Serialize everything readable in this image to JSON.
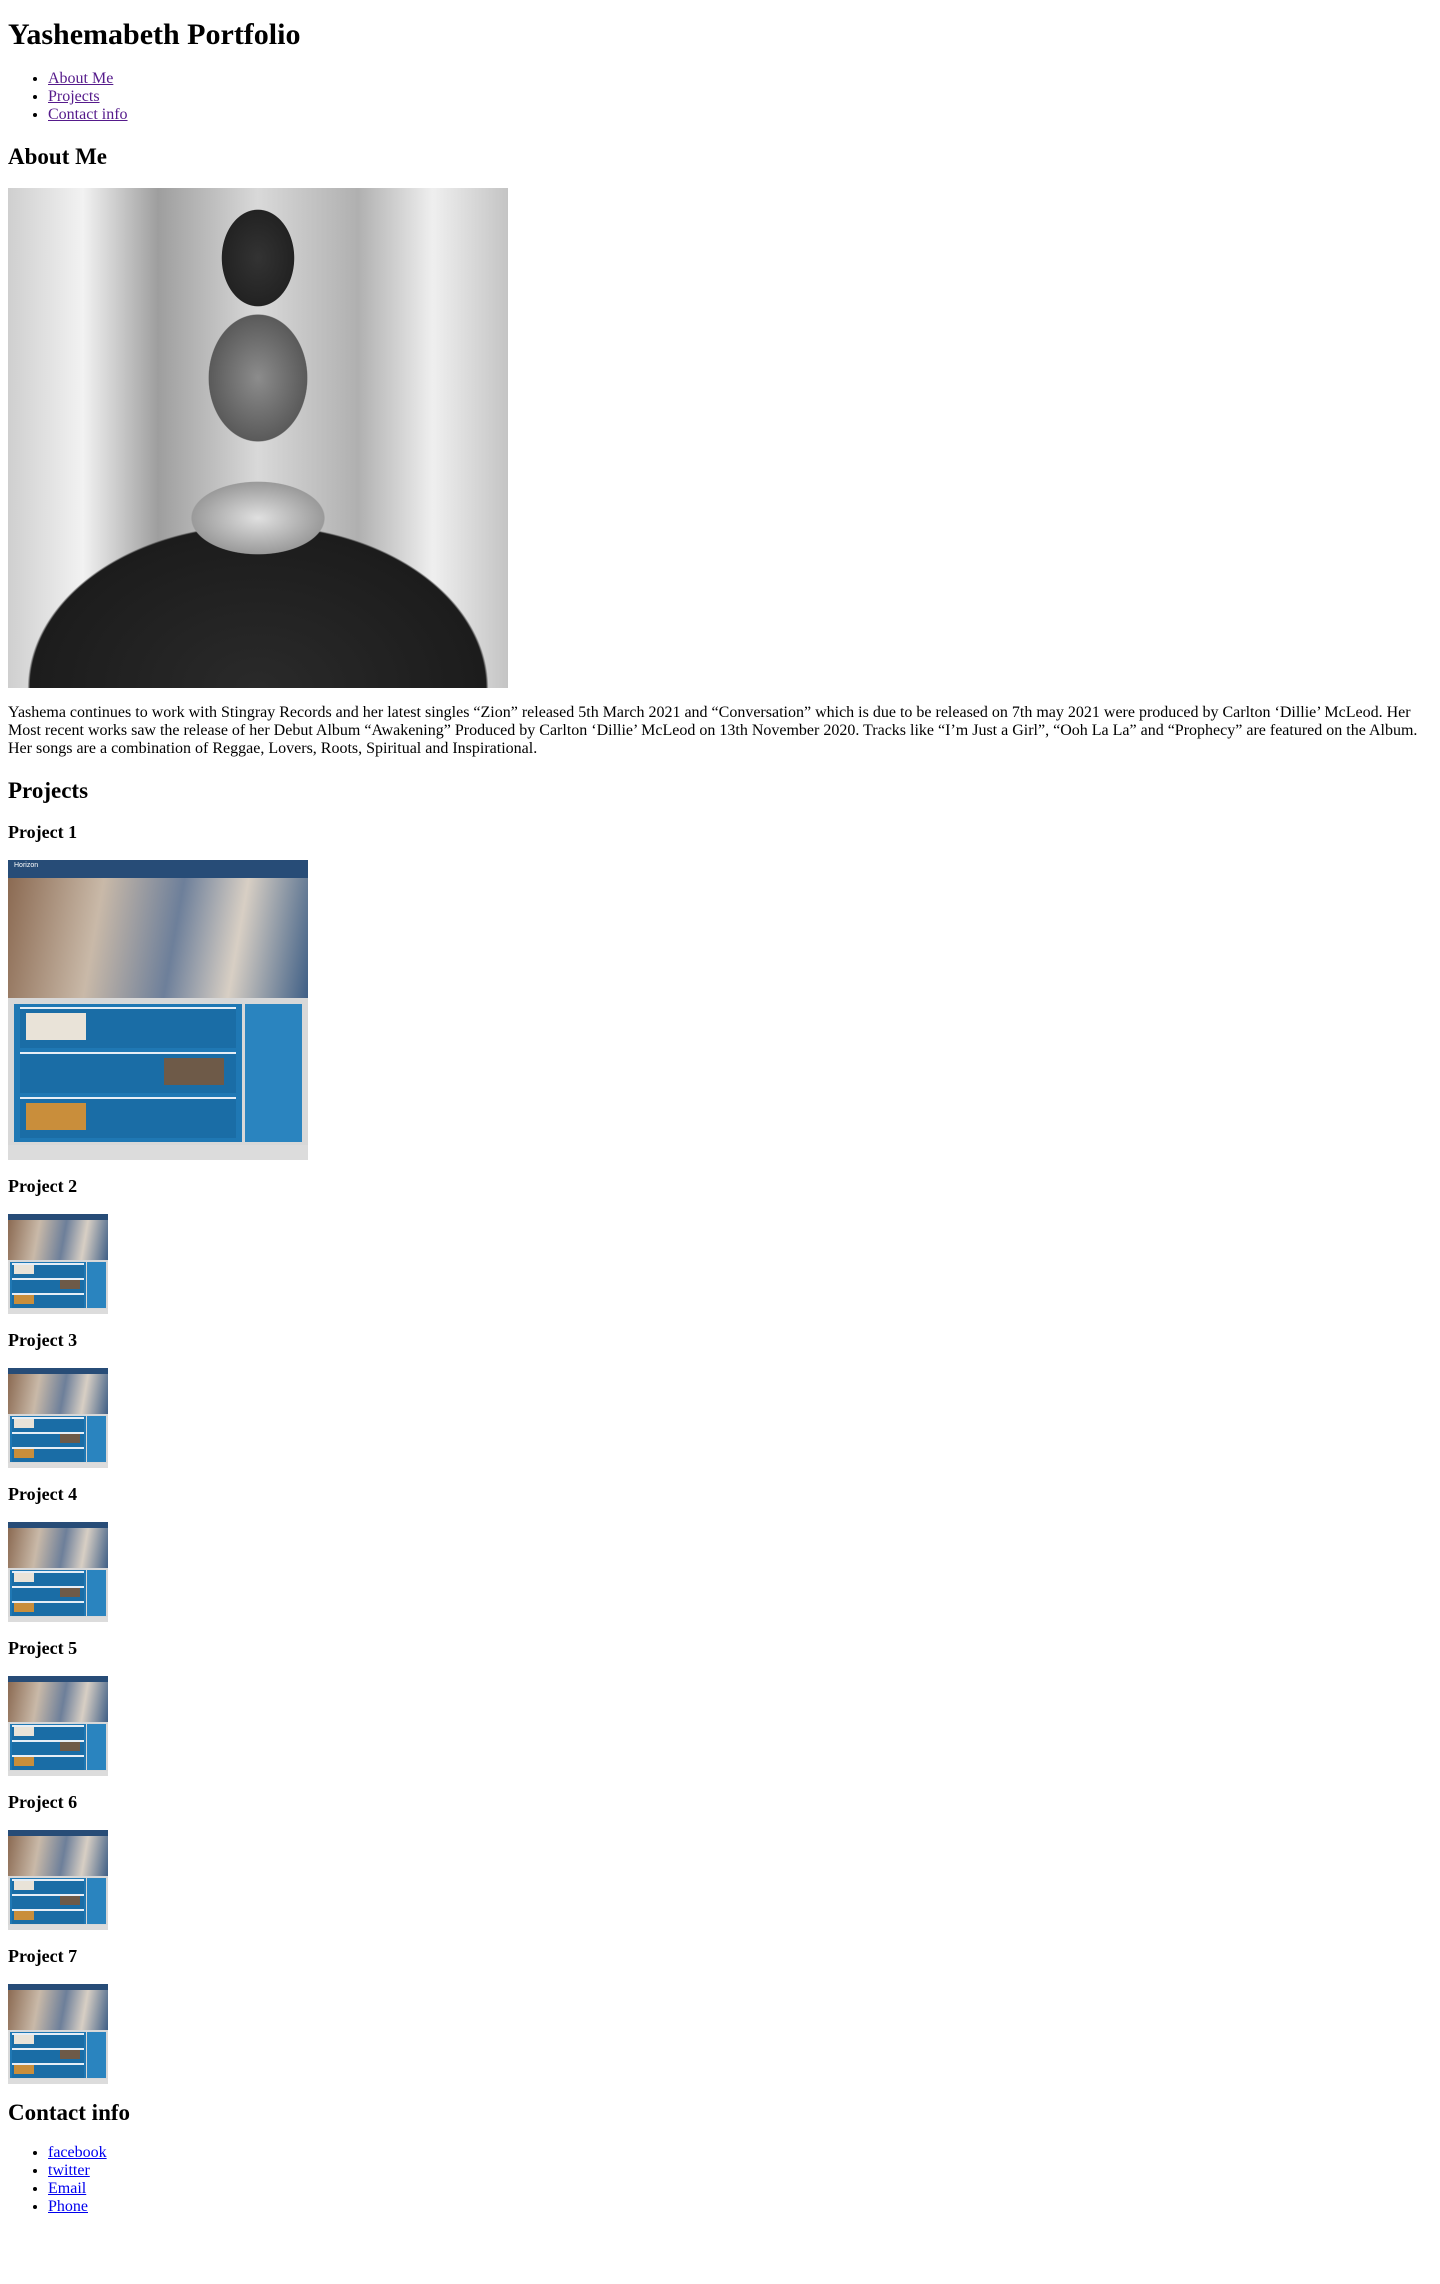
{
  "site": {
    "title": "Yashemabeth Portfolio"
  },
  "nav": {
    "items": [
      {
        "label": "About Me"
      },
      {
        "label": "Projects"
      },
      {
        "label": "Contact info"
      }
    ]
  },
  "about": {
    "heading": "About Me",
    "photo_icon": "portrait-photo",
    "bio": "Yashema continues to work with Stingray Records and her latest singles “Zion” released 5th March 2021 and “Conversation” which is due to be released on 7th may 2021 were produced by Carlton ‘Dillie’ McLeod. Her Most recent works saw the release of her Debut Album “Awakening” Produced by Carlton ‘Dillie’ McLeod on 13th November 2020. Tracks like “I’m Just a Girl”, “Ooh La La” and “Prophecy” are featured on the Album. Her songs are a combination of Reggae, Lovers, Roots, Spiritual and Inspirational."
  },
  "projects": {
    "heading": "Projects",
    "thumbnail_brand": "Horizon",
    "items": [
      {
        "title": "Project 1"
      },
      {
        "title": "Project 2"
      },
      {
        "title": "Project 3"
      },
      {
        "title": "Project 4"
      },
      {
        "title": "Project 5"
      },
      {
        "title": "Project 6"
      },
      {
        "title": "Project 7"
      }
    ]
  },
  "contact": {
    "heading": "Contact info",
    "links": [
      {
        "label": "facebook"
      },
      {
        "label": "twitter"
      },
      {
        "label": "Email"
      },
      {
        "label": "Phone"
      }
    ]
  },
  "colors": {
    "visited_link": "#551a8b",
    "unvisited_link": "#0000ee",
    "text": "#000000",
    "background": "#ffffff"
  }
}
